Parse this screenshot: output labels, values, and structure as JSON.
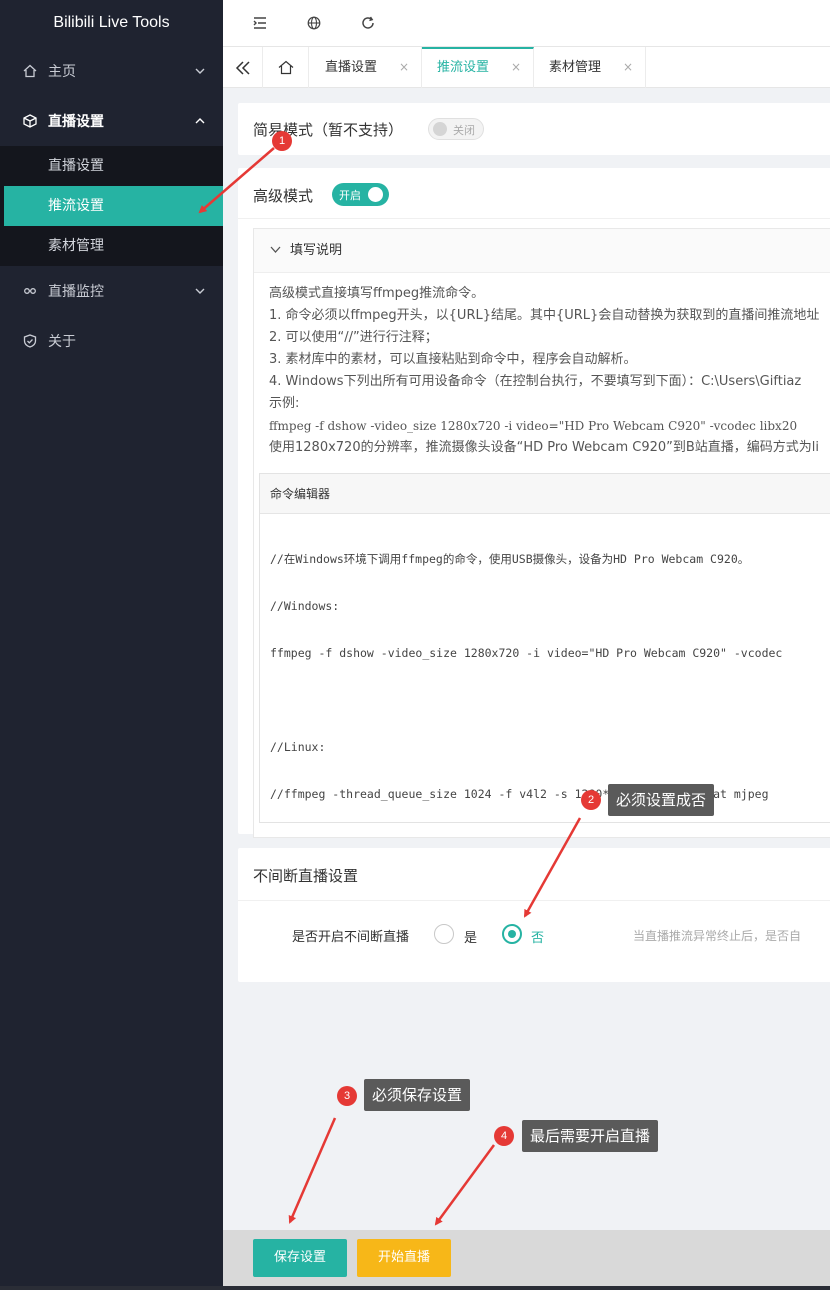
{
  "sidebar": {
    "brand": "Bilibili Live Tools",
    "items": [
      {
        "label": "主页",
        "icon": "home-icon"
      },
      {
        "label": "直播设置",
        "icon": "cube-icon"
      },
      {
        "label": "直播监控",
        "icon": "monitor-icon"
      },
      {
        "label": "关于",
        "icon": "shield-icon"
      }
    ],
    "submenu": [
      "直播设置",
      "推流设置",
      "素材管理"
    ]
  },
  "topbar": {
    "icons": [
      "menu-fold-icon",
      "globe-icon",
      "refresh-icon"
    ]
  },
  "tabs": {
    "items": [
      {
        "label": "直播设置",
        "close": "×"
      },
      {
        "label": "推流设置",
        "close": "×"
      },
      {
        "label": "素材管理",
        "close": "×"
      }
    ],
    "active_index": 1
  },
  "simple_mode": {
    "title": "简易模式（暂不支持）",
    "switch_label": "关闭",
    "switch_on": false
  },
  "advanced_mode": {
    "title": "高级模式",
    "switch_label": "开启",
    "switch_on": true,
    "instructions": {
      "header": "填写说明",
      "lines": [
        "高级模式直接填写ffmpeg推流命令。",
        "1. 命令必须以ffmpeg开头，以{URL}结尾。其中{URL}会自动替换为获取到的直播间推流地址",
        "2. 可以使用“//”进行行注释；",
        "3. 素材库中的素材，可以直接粘贴到命令中，程序会自动解析。",
        "4. Windows下列出所有可用设备命令（在控制台执行，不要填写到下面）：C:\\Users\\Giftiaz",
        "示例:",
        "ffmpeg -f dshow -video_size 1280x720 -i video=\"HD Pro Webcam C920\" -vcodec libx20",
        "使用1280x720的分辨率，推流摄像头设备“HD Pro Webcam C920”到B站直播，编码方式为li"
      ]
    },
    "editor": {
      "header": "命令编辑器",
      "lines": [
        "//在Windows环境下调用ffmpeg的命令，使用USB摄像头，设备为HD Pro Webcam C920。",
        "//Windows:",
        "ffmpeg -f dshow -video_size 1280x720 -i video=\"HD Pro Webcam C920\" -vcodec",
        "",
        "//Linux:",
        "//ffmpeg -thread_queue_size 1024 -f v4l2 -s 1280*720 -input_format mjpeg"
      ]
    }
  },
  "continuous": {
    "title": "不间断直播设置",
    "field_label": "是否开启不间断直播",
    "option_yes": "是",
    "option_no": "否",
    "selected": "否",
    "hint": "当直播推流异常终止后，是否自"
  },
  "buttons": {
    "save": "保存设置",
    "start": "开始直播"
  },
  "annotations": [
    {
      "number": "1",
      "text": ""
    },
    {
      "number": "2",
      "text": "必须设置成否"
    },
    {
      "number": "3",
      "text": "必须保存设置"
    },
    {
      "number": "4",
      "text": "最后需要开启直播"
    }
  ],
  "colors": {
    "sidebar_bg": "#1f2330",
    "accent": "#26b3a3",
    "start_button": "#f7b718",
    "annotation_red": "#e53935",
    "callout_bg": "#5a5a5a"
  }
}
